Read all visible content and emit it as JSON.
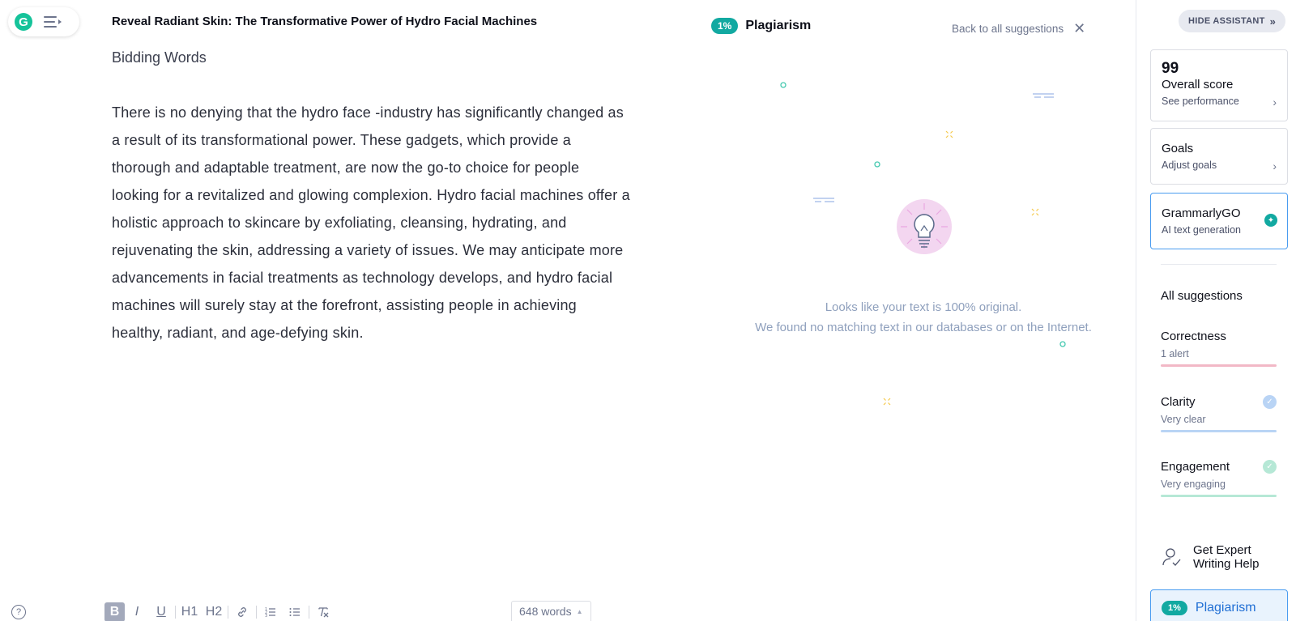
{
  "header": {
    "doc_title": "Reveal Radiant Skin: The Transformative Power of Hydro Facial Machines"
  },
  "document": {
    "heading": "Bidding Words",
    "body": "There is no denying that the hydro face -industry has significantly changed as a result of its transformational power. These gadgets, which provide a thorough and adaptable treatment, are now the go-to choice for people looking for a revitalized and glowing complexion. Hydro facial machines offer a holistic approach to skincare by exfoliating, cleansing, hydrating, and rejuvenating the skin, addressing a variety of issues. We may anticipate more advancements in facial treatments as technology develops, and hydro facial machines will surely stay at the forefront, assisting people in achieving healthy, radiant, and age-defying skin."
  },
  "toolbar": {
    "help": "?",
    "bold": "B",
    "italic": "I",
    "underline": "U",
    "h1": "H1",
    "h2": "H2",
    "word_count": "648 words"
  },
  "plagiarism_panel": {
    "badge": "1%",
    "title": "Plagiarism",
    "back_link": "Back to all suggestions",
    "message_line1": "Looks like your text is 100% original.",
    "message_line2": "We found no matching text in our databases or on the Internet."
  },
  "sidebar": {
    "hide_button": "HIDE ASSISTANT",
    "overall": {
      "score": "99",
      "title": "Overall score",
      "link": "See performance"
    },
    "goals": {
      "title": "Goals",
      "link": "Adjust goals"
    },
    "grammarly_go": {
      "title": "GrammarlyGO",
      "subtitle": "AI text generation"
    },
    "all_suggestions": "All suggestions",
    "categories": [
      {
        "label": "Correctness",
        "sub": "1 alert",
        "color": "#f2b8c6"
      },
      {
        "label": "Clarity",
        "sub": "Very clear",
        "color": "#b9d4f5"
      },
      {
        "label": "Engagement",
        "sub": "Very engaging",
        "color": "#b6e8d6"
      }
    ],
    "expert_help": "Get Expert Writing Help",
    "plagiarism": {
      "badge": "1%",
      "label": "Plagiarism"
    }
  },
  "colors": {
    "brand_green": "#15c39a",
    "teal": "#12a9a1",
    "accent_blue": "#4a9cf0"
  }
}
